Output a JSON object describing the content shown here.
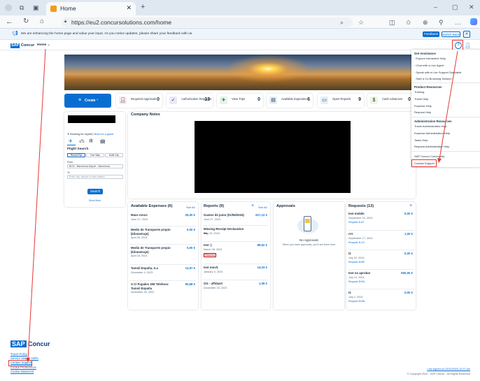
{
  "browser": {
    "tab_title": "Home",
    "url": "https://eu2.concursolutions.com/home"
  },
  "banner": {
    "text": "We are enhancing the home page and value your input. As you notice updates, please share your feedback with us.",
    "feedback_label": "Feedback",
    "switch_back_label": "Switch Back"
  },
  "header": {
    "brand_sap": "SAP",
    "brand_concur": "Concur",
    "nav_home": "Home"
  },
  "tiles": {
    "create": "Create",
    "items": [
      {
        "label": "Required Approvals",
        "count": "0",
        "icon": "user-icon",
        "color": "#fde8ec"
      },
      {
        "label": "Authorization Requests",
        "count": "13",
        "icon": "check-icon",
        "color": "#ece8fb"
      },
      {
        "label": "View Trips",
        "count": "0",
        "icon": "trip-icon",
        "color": "#e3f4e8"
      },
      {
        "label": "Available Expenses",
        "count": "6",
        "icon": "expense-icon",
        "color": "#e3eefb"
      },
      {
        "label": "Open Reports",
        "count": "9",
        "icon": "folder-icon",
        "color": "#e3eefb"
      },
      {
        "label": "Cash Advances",
        "count": "0",
        "icon": "cash-icon",
        "color": "#eef7df"
      }
    ]
  },
  "booking": {
    "booking_for": "Booking for myself",
    "book_guest": "Book for a guest",
    "flight_search": "Flight Search",
    "trip_types": [
      "Round Trip",
      "One Way",
      "Multi City"
    ],
    "from_label": "From",
    "from_value": "BCN - Barcelona Airport - Barcelona",
    "to_label": "To",
    "to_placeholder": "Enter city, airport or train station",
    "search_label": "Search",
    "show_more": "Show More"
  },
  "company_notes": {
    "title": "Company Notes"
  },
  "expenses": {
    "title": "Available Expenses (6)",
    "see_all": "See All",
    "items": [
      {
        "name": "Mass Amco",
        "date": "June 27, 2024",
        "amount": "25,00 €"
      },
      {
        "name": "Medio de Transporte propio (kilometraje)",
        "date": "April 26, 2024",
        "amount": "0,00 €"
      },
      {
        "name": "Medio de Transporte propio (kilometraje)",
        "date": "April 16, 2024",
        "amount": "0,00 €"
      },
      {
        "name": "Tamoil España, S.a",
        "date": "December 4, 2023",
        "amount": "13,97 €"
      },
      {
        "name": "S Ci Pujades 309 Telefono: Tamoil España",
        "date": "November 25, 2022",
        "amount": "50,68 €"
      }
    ]
  },
  "reports": {
    "title": "Reports (9)",
    "see_all": "See All",
    "items": [
      {
        "name": "Gastos de junio (01/06/2024)",
        "date": "June 27, 2024",
        "amount": "617,12 €"
      },
      {
        "name": "Missing Receipt Declaration ex.",
        "date": "May 29, 2024",
        "amount": ""
      },
      {
        "name": "test :)",
        "date": "March 28, 2024",
        "amount": "89,52 €",
        "status": "Returned"
      },
      {
        "name": "test movil.",
        "date": "January 3, 2024",
        "amount": "14,03 €"
      },
      {
        "name": "OG - affidavit",
        "date": "December 15, 2023",
        "amount": "1,06 €"
      }
    ]
  },
  "approvals": {
    "title": "Approvals",
    "empty_title": "No Approvals",
    "empty_text": "When you have approvals, you'll see them here"
  },
  "requests": {
    "title": "Requests (13)",
    "items": [
      {
        "name": "test mobile",
        "date": "September 23, 2024",
        "amount": "0,00 €",
        "id": "Request 3L87"
      },
      {
        "name": "rrrr",
        "date": "September 17, 2024",
        "amount": "1,00 €",
        "id": "Request 3L1O"
      },
      {
        "name": "t1",
        "date": "July 22, 2024",
        "amount": "0,00 €",
        "id": "Request 3K8P"
      },
      {
        "name": "test no aprobar",
        "date": "July 10, 2024",
        "amount": "600,00 €",
        "id": "Request 3K9U"
      },
      {
        "name": "t1",
        "date": "July 2, 2024",
        "amount": "0,00 €",
        "id": "Request 3K8N"
      }
    ]
  },
  "help_menu": {
    "get_assistance": "Get Assistance",
    "assist_items": [
      "Explore Interactive Help",
      "Chat with a Live Agent",
      "Speak with a Live Support Specialist",
      "Start a Co-Browsing Session"
    ],
    "product_resources": "Product Resources",
    "product_items": [
      "Training",
      "Travel Help",
      "Expense Help",
      "Request Help"
    ],
    "admin_resources": "Administration Resources",
    "admin_items": [
      "Travel Administration Help",
      "Expense Administration Help",
      "Tasks Help",
      "Request Administration Help"
    ],
    "community": "SAP Concur Community",
    "contact_support": "Contact Support"
  },
  "footer": {
    "brand_sap": "SAP",
    "brand_concur": "Concur",
    "links": [
      "Travel Policy",
      "Service Status: 100%",
      "Contact Support",
      "Cookie Preferences",
      "Cookie Statement"
    ],
    "last_signed": "Last signed on 23/10/2024 10:27 am",
    "copyright": "© Copyright 2024 - SAP Concur - All Rights Reserved"
  }
}
